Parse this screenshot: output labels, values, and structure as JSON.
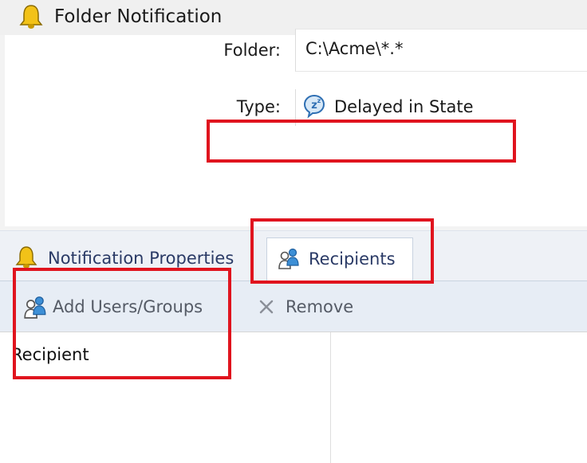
{
  "window": {
    "title": "Folder Notification",
    "icon": "bell-icon"
  },
  "form": {
    "folder_label": "Folder:",
    "folder_value": "C:\\Acme\\*.*",
    "type_label": "Type:",
    "type_value": "Delayed in State",
    "type_icon": "delayed-state-icon"
  },
  "tabs": [
    {
      "label": "Notification Properties",
      "icon": "bell-icon",
      "selected": false
    },
    {
      "label": "Recipients",
      "icon": "users-icon",
      "selected": true
    }
  ],
  "toolbar": {
    "add_label": "Add Users/Groups",
    "add_icon": "users-icon",
    "remove_label": "Remove",
    "remove_icon": "x-icon"
  },
  "recipients_list": {
    "column_header": "Recipient"
  },
  "colors": {
    "highlight": "#e0141e",
    "tab_text": "#2a3a66",
    "bell_yellow": "#f2c218"
  }
}
